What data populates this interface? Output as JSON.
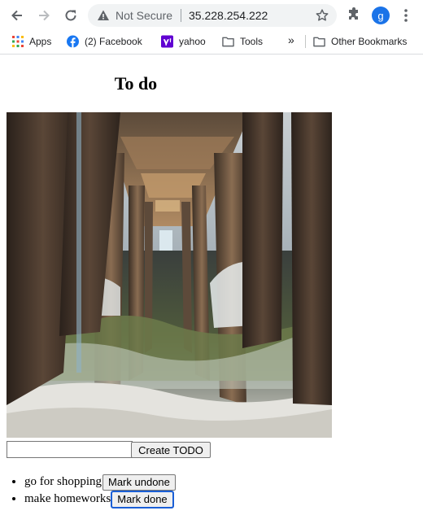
{
  "browser": {
    "security_status": "Not Secure",
    "url": "35.228.254.222",
    "profile_initial": "g"
  },
  "bookmarks": {
    "apps": "Apps",
    "facebook": "(2) Facebook",
    "yahoo": "yahoo",
    "tools": "Tools",
    "overflow": "»",
    "other": "Other Bookmarks"
  },
  "page": {
    "title": "To do",
    "input_value": "",
    "create_label": "Create TODO"
  },
  "todos": [
    {
      "text": "go for shopping",
      "button": "Mark undone"
    },
    {
      "text": "make homeworks",
      "button": "Mark done"
    }
  ]
}
